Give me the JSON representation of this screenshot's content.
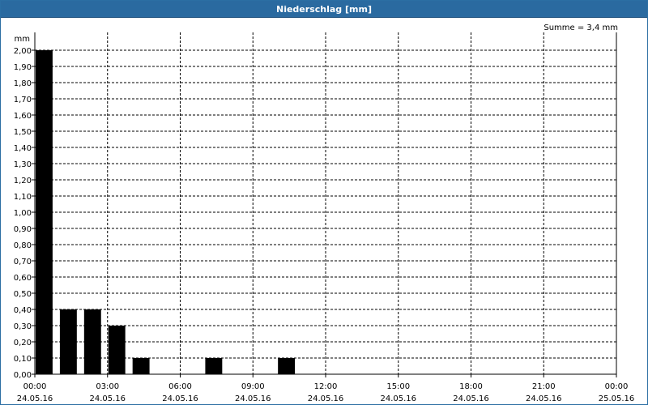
{
  "window": {
    "title": "Niederschlag [mm]"
  },
  "chart_data": {
    "type": "bar",
    "title": "Niederschlag [mm]",
    "ylabel": "mm",
    "sum_label": "Summe = 3,4 mm",
    "ylim": [
      0,
      2.0
    ],
    "yticks": [
      "0,00",
      "0,10",
      "0,20",
      "0,30",
      "0,40",
      "0,50",
      "0,60",
      "0,70",
      "0,80",
      "0,90",
      "1,00",
      "1,10",
      "1,20",
      "1,30",
      "1,40",
      "1,50",
      "1,60",
      "1,70",
      "1,80",
      "1,90",
      "2,00"
    ],
    "xlim_hours": [
      0,
      24
    ],
    "xticks": [
      {
        "hour": 0,
        "time": "00:00",
        "date": "24.05.16"
      },
      {
        "hour": 3,
        "time": "03:00",
        "date": "24.05.16"
      },
      {
        "hour": 6,
        "time": "06:00",
        "date": "24.05.16"
      },
      {
        "hour": 9,
        "time": "09:00",
        "date": "24.05.16"
      },
      {
        "hour": 12,
        "time": "12:00",
        "date": "24.05.16"
      },
      {
        "hour": 15,
        "time": "15:00",
        "date": "24.05.16"
      },
      {
        "hour": 18,
        "time": "18:00",
        "date": "24.05.16"
      },
      {
        "hour": 21,
        "time": "21:00",
        "date": "24.05.16"
      },
      {
        "hour": 24,
        "time": "00:00",
        "date": "25.05.16"
      }
    ],
    "bars": [
      {
        "hour": 0,
        "value": 2.0
      },
      {
        "hour": 1,
        "value": 0.4
      },
      {
        "hour": 2,
        "value": 0.4
      },
      {
        "hour": 3,
        "value": 0.3
      },
      {
        "hour": 4,
        "value": 0.1
      },
      {
        "hour": 7,
        "value": 0.1
      },
      {
        "hour": 10,
        "value": 0.1
      }
    ],
    "grid": true,
    "bar_color": "#000000"
  }
}
